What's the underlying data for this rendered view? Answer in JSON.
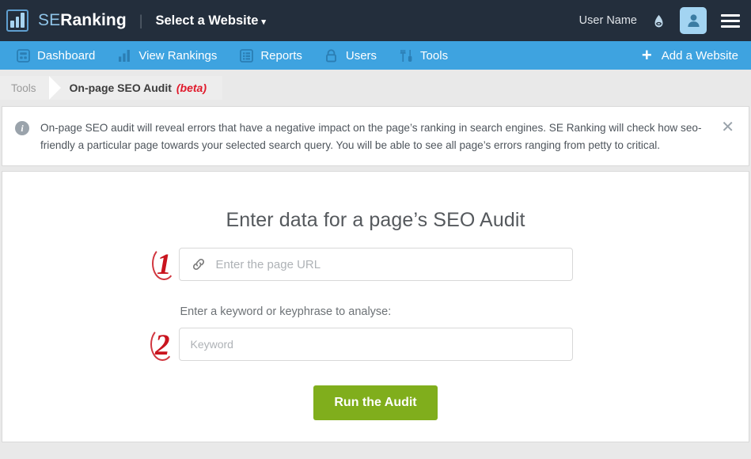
{
  "header": {
    "logo_icon": "bar-chart-logo-icon",
    "brand_se": "SE",
    "brand_ranking": "Ranking",
    "divider": "|",
    "site_selector": "Select a Website",
    "site_selector_caret": "▾",
    "user_name": "User Name",
    "bell_icon": "notification-bell-icon",
    "avatar_icon": "user-avatar-icon",
    "menu_icon": "hamburger-menu-icon",
    "bg_color": "#232e3c",
    "avatar_bg": "#a3d4f2"
  },
  "nav": {
    "bg_color": "#3ea3e0",
    "items": [
      {
        "label": "Dashboard",
        "icon": "dashboard-grid-icon"
      },
      {
        "label": "View Rankings",
        "icon": "bar-chart-icon"
      },
      {
        "label": "Reports",
        "icon": "report-list-icon"
      },
      {
        "label": "Users",
        "icon": "lock-icon"
      },
      {
        "label": "Tools",
        "icon": "tools-fork-knife-icon"
      }
    ],
    "add_website": {
      "label": "Add a Website",
      "icon": "plus-icon"
    }
  },
  "breadcrumb": {
    "parent": "Tools",
    "current": "On-page SEO Audit",
    "badge": "(beta)",
    "badge_color": "#e0192b"
  },
  "notice": {
    "icon": "info-icon",
    "text": "On-page SEO audit will reveal errors that have a negative impact on the page’s ranking in search engines. SE Ranking will check how seo-friendly a particular page towards your selected search query. You will be able to see all page’s errors ranging from petty to critical.",
    "close_icon": "close-icon"
  },
  "form": {
    "title": "Enter data for a page’s SEO Audit",
    "url_field": {
      "icon": "link-icon",
      "value": "",
      "placeholder": "Enter the page URL",
      "annotation": "1"
    },
    "keyword_label": "Enter a keyword or keyphrase to analyse:",
    "keyword_field": {
      "value": "",
      "placeholder": "Keyword",
      "annotation": "2"
    },
    "submit_label": "Run the Audit",
    "submit_color": "#80ae1c",
    "annotation_color": "#c9141e"
  }
}
